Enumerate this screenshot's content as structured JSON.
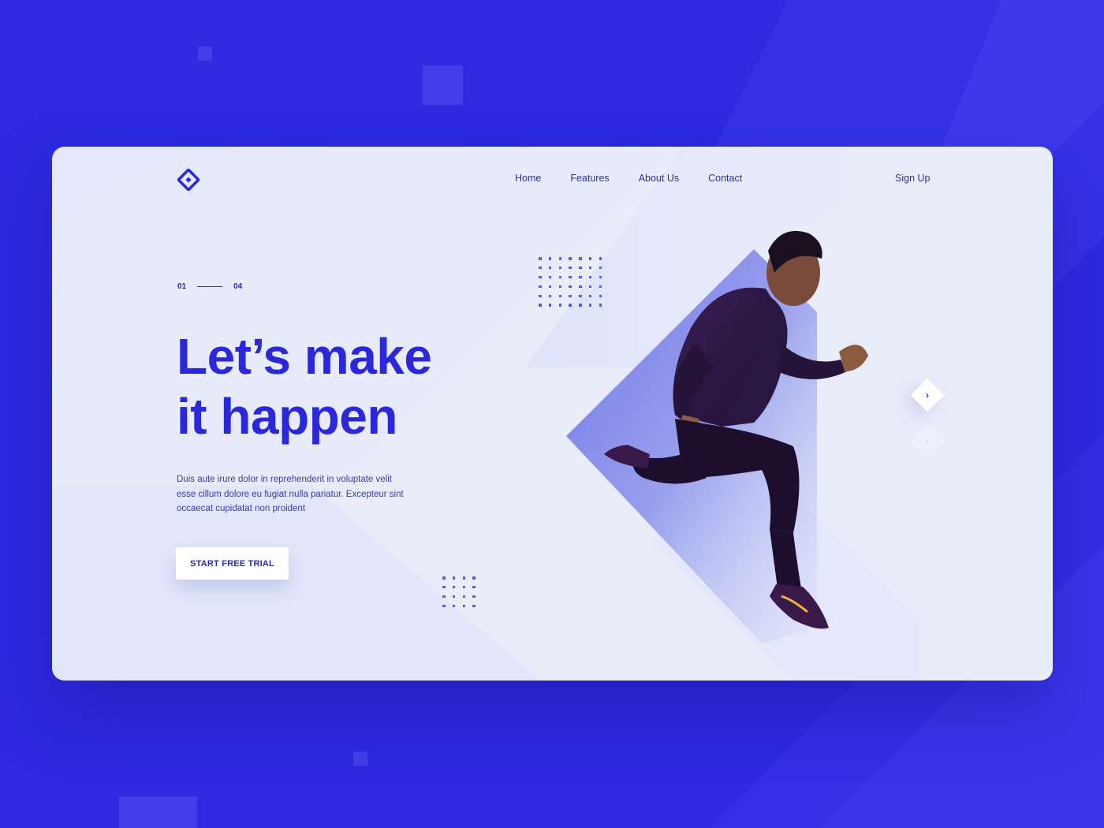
{
  "brand": {
    "logo_icon": "diamond-logo-icon"
  },
  "nav": {
    "links": [
      "Home",
      "Features",
      "About Us",
      "Contact"
    ],
    "signup_label": "Sign Up"
  },
  "slide_counter": {
    "current": "01",
    "total": "04"
  },
  "hero": {
    "headline_line1": "Let’s make",
    "headline_line2": "it happen",
    "body_line1": "Duis aute irure dolor in reprehenderit in voluptate velit",
    "body_line2": "esse cillum dolore eu fugiat nulla pariatur. Excepteur sint",
    "body_line3": "occaecat cupidatat non proident",
    "cta_label": "START FREE TRIAL"
  },
  "slider": {
    "next_icon": "chevron-right-icon",
    "prev_icon": "chevron-left-icon",
    "next_glyph": "›",
    "prev_glyph": "‹"
  },
  "colors": {
    "background": "#2d2ae0",
    "card": "#e9edfa",
    "accent": "#2b27dc",
    "dots": "#5b5ce0"
  }
}
